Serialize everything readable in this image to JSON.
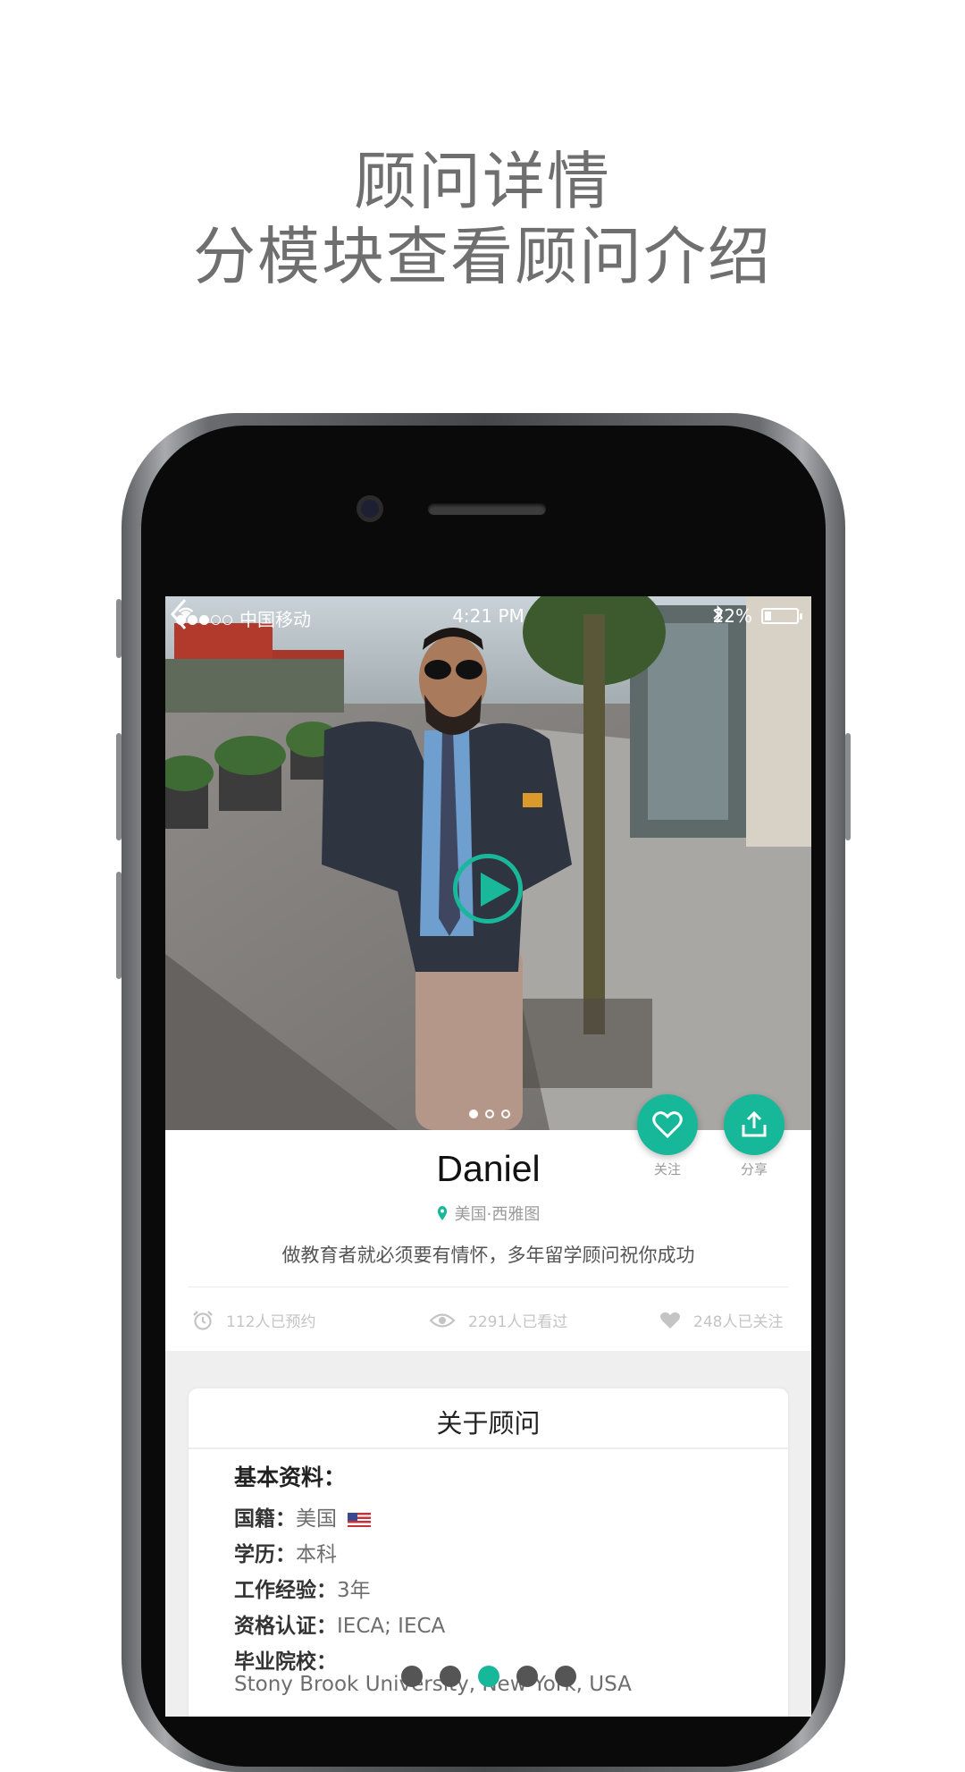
{
  "promo": {
    "line1": "顾问详情",
    "line2": "分模块查看顾问介绍"
  },
  "status_bar": {
    "carrier": "中国移动",
    "time": "4:21 PM",
    "battery": "22%",
    "battery_level": 0.22,
    "signal_filled": 3,
    "signal_total": 5
  },
  "hero": {
    "page_count": 3,
    "active_page": 0
  },
  "actions": {
    "follow_label": "关注",
    "share_label": "分享"
  },
  "profile": {
    "name": "Daniel",
    "location": "美国·西雅图",
    "bio": "做教育者就必须要有情怀，多年留学顾问祝你成功"
  },
  "stats": {
    "booked": "112人已预约",
    "viewed": "2291人已看过",
    "followed": "248人已关注"
  },
  "about": {
    "title": "关于顾问",
    "section": "基本资料：",
    "nationality_label": "国籍：",
    "nationality": "美国",
    "education_label": "学历：",
    "education": "本科",
    "experience_label": "工作经验：",
    "experience": "3年",
    "certification_label": "资格认证：",
    "certification": "IECA; IECA",
    "school_label": "毕业院校：",
    "school": "Stony Brook University, New York, USA"
  },
  "screenshot_pager": {
    "count": 5,
    "active": 2
  },
  "colors": {
    "accent": "#17b79a",
    "headline": "#6f6f6f"
  }
}
